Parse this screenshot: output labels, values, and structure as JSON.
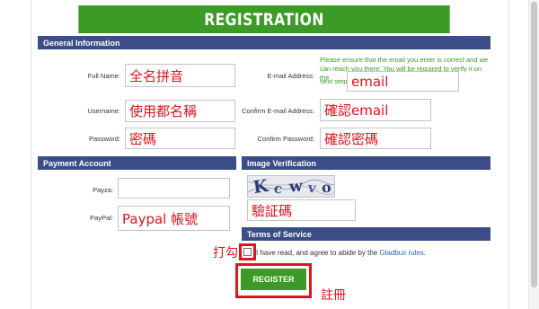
{
  "title": "REGISTRATION",
  "sections": {
    "general": "General Information",
    "payment": "Payment Account",
    "verification": "Image Verification",
    "terms": "Terms of Service"
  },
  "labels": {
    "full_name": "Full Name:",
    "username": "Username:",
    "password": "Password:",
    "email": "E-mail Address:",
    "confirm_email": "Confirm E-mail Address:",
    "confirm_password": "Confirm Password:",
    "payza": "Payza:",
    "paypal": "PayPal:"
  },
  "email_note_line1": "Please ensure that the email you enter is correct and we",
  "email_note_line2": "can reach you there. You will be required to verify it on the",
  "email_note_line3": "next step.",
  "fields": {
    "full_name": "全名拼音",
    "username": "使用都名稱",
    "password": "密碼",
    "email": "email",
    "confirm_email": "確認email",
    "confirm_password": "確認密碼",
    "payza": "",
    "paypal": "Paypal 帳號",
    "captcha": "驗証碼"
  },
  "captcha_chars": [
    "K",
    "c",
    "w",
    "v",
    "o"
  ],
  "terms": {
    "before": "I have read, and agree to abide by the ",
    "link": "Gladbux rules",
    "after": "."
  },
  "annotations": {
    "check": "打勾",
    "register": "註冊"
  },
  "register_button": "REGISTER"
}
